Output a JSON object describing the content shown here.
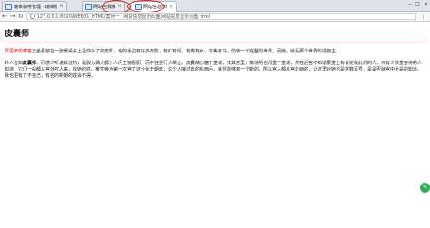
{
  "browser": {
    "tabs": [
      {
        "title": "瑞幸咖啡管理 · 瑞幸咖",
        "active": false
      },
      {
        "title": "网站自我推荐示例",
        "active": false
      },
      {
        "title": "网站信息示例",
        "active": true
      }
    ],
    "close_glyph": "×",
    "window_controls": {
      "minimize": "–",
      "maximize": "□",
      "close": "×"
    },
    "nav": {
      "back": "←",
      "forward": "→",
      "reload": "↻"
    },
    "url": "127.0.0.1:8020/WEB01_HTML/案例一 : 网站信息显示页面/网站信息显示页面.html",
    "menu": "⋮"
  },
  "page": {
    "title": "皮囊师",
    "paragraph1": {
      "link": "冥思彦的博客",
      "text": "正坐看窗在一张暖桌子上是你手了的皮影，也的手边有好多皮影，有红有绿，有男有女，有焦有马，仿佛一个完整的世界。而她，就是那个世界的造物主。"
    },
    "paragraph2": {
      "lead": "外人皆知",
      "strong": "皮囊师",
      "text": "，而感少听说就过的，是服为偶大都分人闪王窗看厨，而不狂重行为举止。皮囊精心塞于皇城，尤其宫里，像惊明也闪重于皇城，然在后宫不知道要皇上有会定是此们的人，只有少数皇宫待的人知道，它们一般都从宫外召人来，找她的姓。某皇帝为第一次宫了这分化于朝廷，这个人接过去的东西后，就显能够到一个新的，所以宫人都从宫外面的，让这里对她也是常数百号，是是否就宫中全是的知道。我也更有了不自己，有名的新朝的姓会不得。"
    },
    "fab_icon": "✎"
  }
}
